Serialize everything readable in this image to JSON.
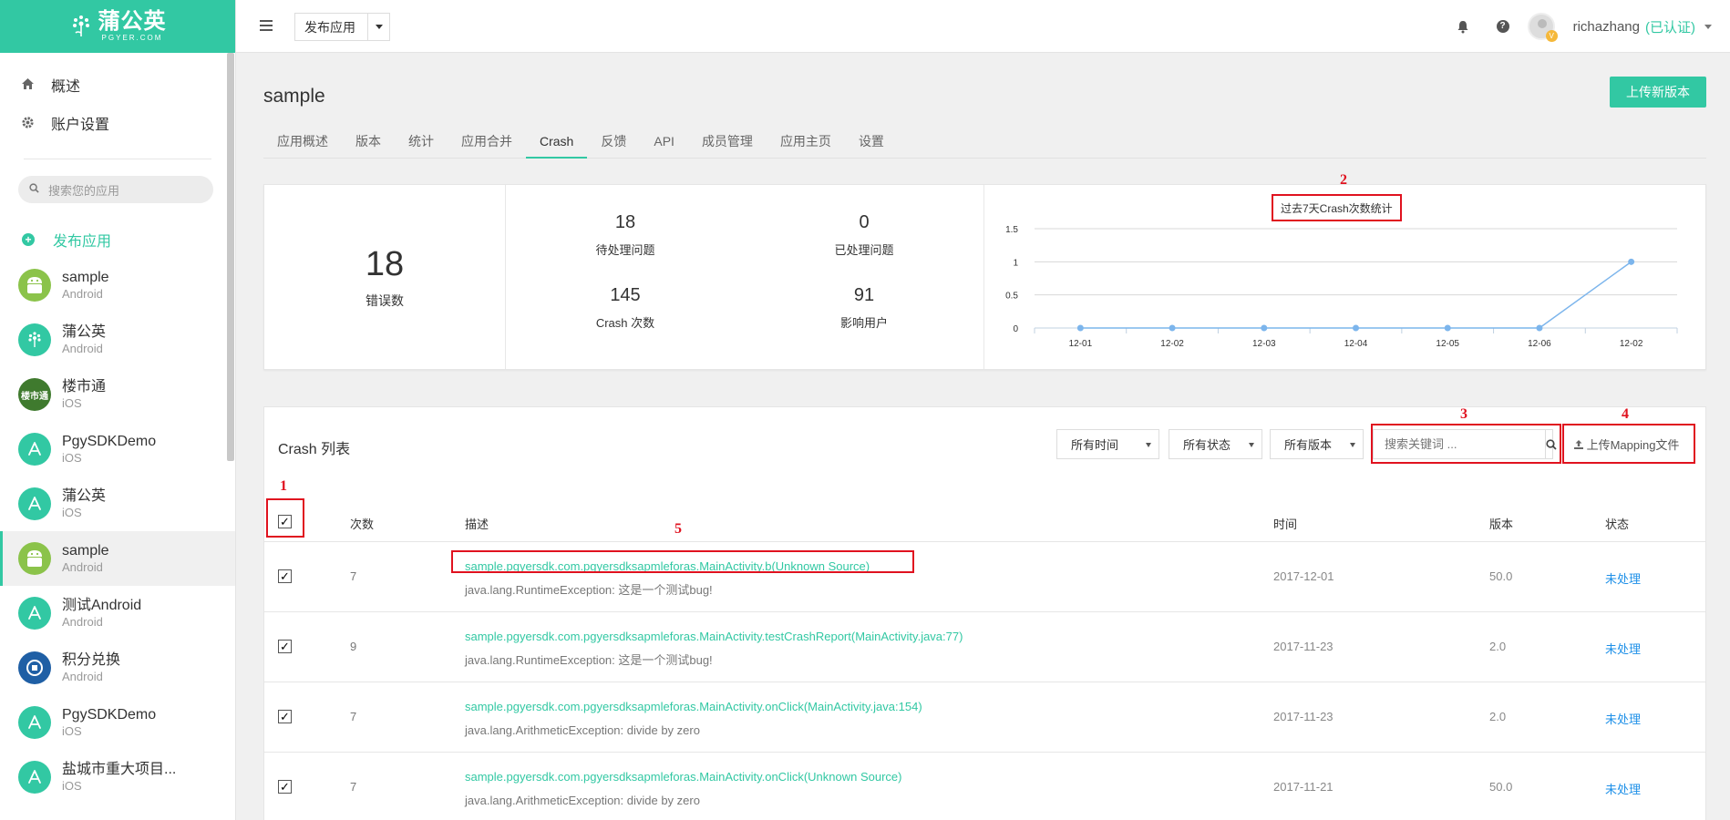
{
  "brand": {
    "title": "蒲公英",
    "sub": "PGYER.COM",
    "color": "#32c8a3"
  },
  "sidebar": {
    "nav": [
      {
        "label": "概述",
        "icon": "home-icon"
      },
      {
        "label": "账户设置",
        "icon": "gear-icon"
      }
    ],
    "search_placeholder": "搜索您的应用",
    "publish_label": "发布应用",
    "apps": [
      {
        "name": "sample",
        "os": "Android",
        "icon": "android",
        "color": "#8bc34a"
      },
      {
        "name": "蒲公英",
        "os": "Android",
        "icon": "dandelion",
        "color": "#32c8a3"
      },
      {
        "name": "楼市通",
        "os": "iOS",
        "icon": "text",
        "text": "楼市通",
        "color": "#3f7a2e"
      },
      {
        "name": "PgySDKDemo",
        "os": "iOS",
        "icon": "A",
        "color": "#32c8a3"
      },
      {
        "name": "蒲公英",
        "os": "iOS",
        "icon": "A",
        "color": "#32c8a3"
      },
      {
        "name": "sample",
        "os": "Android",
        "icon": "android",
        "color": "#8bc34a",
        "active": true
      },
      {
        "name": "测试Android",
        "os": "Android",
        "icon": "A",
        "color": "#32c8a3"
      },
      {
        "name": "积分兑换",
        "os": "Android",
        "icon": "exchange",
        "color": "#1f5fa5"
      },
      {
        "name": "PgySDKDemo",
        "os": "iOS",
        "icon": "A",
        "color": "#32c8a3"
      },
      {
        "name": "盐城市重大项目...",
        "os": "iOS",
        "icon": "A",
        "color": "#32c8a3"
      }
    ]
  },
  "topbar": {
    "app_select": "发布应用",
    "username": "richazhang",
    "verified": "(已认证)",
    "avatar_badge": "V"
  },
  "page": {
    "title": "sample",
    "upload_button": "上传新版本",
    "tabs": [
      "应用概述",
      "版本",
      "统计",
      "应用合并",
      "Crash",
      "反馈",
      "API",
      "成员管理",
      "应用主页",
      "设置"
    ],
    "active_tab": "Crash"
  },
  "stats": {
    "errors": {
      "value": "18",
      "label": "错误数"
    },
    "pending": {
      "value": "18",
      "label": "待处理问题"
    },
    "handled": {
      "value": "0",
      "label": "已处理问题"
    },
    "crashes": {
      "value": "145",
      "label": "Crash 次数"
    },
    "users": {
      "value": "91",
      "label": "影响用户"
    }
  },
  "chart_data": {
    "type": "line",
    "title": "过去7天Crash次数统计",
    "categories": [
      "12-01",
      "12-02",
      "12-03",
      "12-04",
      "12-05",
      "12-06",
      "12-02"
    ],
    "values": [
      0,
      0,
      0,
      0,
      0,
      0,
      1
    ],
    "ylim": [
      0,
      1.5
    ],
    "yticks": [
      "0",
      "0.5",
      "1",
      "1.5"
    ],
    "grid": true,
    "line_color": "#7cb5ec"
  },
  "crash_list": {
    "title": "Crash 列表",
    "filters": [
      "所有时间",
      "所有状态",
      "所有版本"
    ],
    "search_placeholder": "搜索关键词 ...",
    "mapping_button": "上传Mapping文件",
    "columns": {
      "count": "次数",
      "desc": "描述",
      "time": "时间",
      "version": "版本",
      "status": "状态"
    },
    "rows": [
      {
        "count": "7",
        "title": "sample.pgyersdk.com.pgyersdksapmleforas.MainActivity.b(Unknown Source)",
        "exception": "java.lang.RuntimeException: 这是一个测试bug!",
        "time": "2017-12-01",
        "version": "50.0",
        "status": "未处理"
      },
      {
        "count": "9",
        "title": "sample.pgyersdk.com.pgyersdksapmleforas.MainActivity.testCrashReport(MainActivity.java:77)",
        "exception": "java.lang.RuntimeException: 这是一个测试bug!",
        "time": "2017-11-23",
        "version": "2.0",
        "status": "未处理"
      },
      {
        "count": "7",
        "title": "sample.pgyersdk.com.pgyersdksapmleforas.MainActivity.onClick(MainActivity.java:154)",
        "exception": "java.lang.ArithmeticException: divide by zero",
        "time": "2017-11-23",
        "version": "2.0",
        "status": "未处理"
      },
      {
        "count": "7",
        "title": "sample.pgyersdk.com.pgyersdksapmleforas.MainActivity.onClick(Unknown Source)",
        "exception": "java.lang.ArithmeticException: divide by zero",
        "time": "2017-11-21",
        "version": "50.0",
        "status": "未处理"
      }
    ]
  },
  "annotations": [
    "1",
    "2",
    "3",
    "4",
    "5"
  ],
  "annotation_color": "#e0121f"
}
